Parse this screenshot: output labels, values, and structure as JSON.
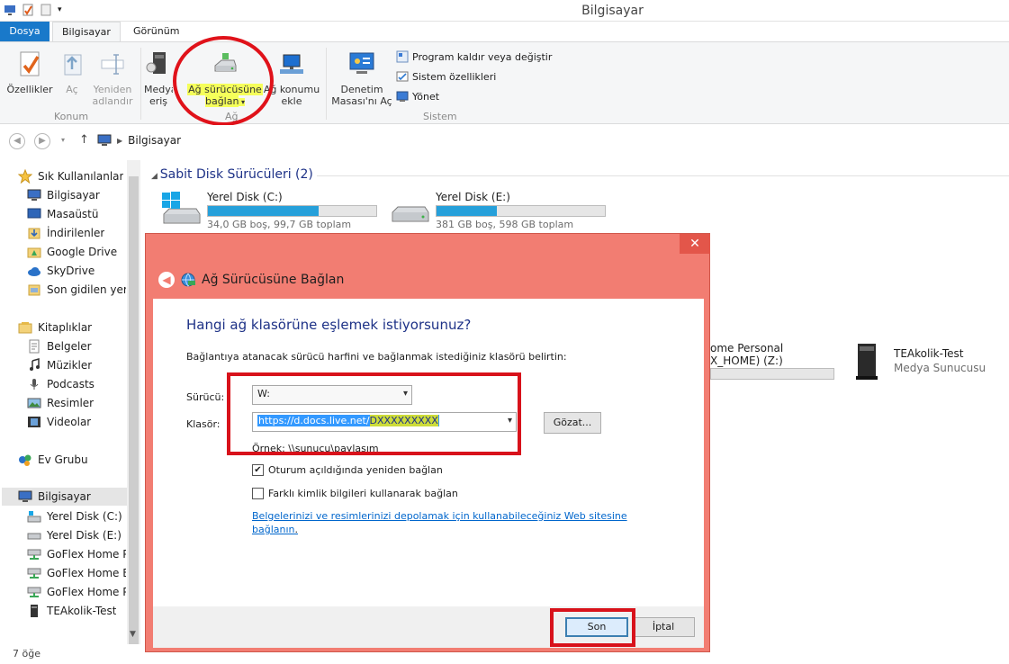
{
  "window": {
    "title": "Bilgisayar"
  },
  "tabs": {
    "file": "Dosya",
    "computer": "Bilgisayar",
    "view": "Görünüm"
  },
  "ribbon": {
    "properties": "Özellikler",
    "open": "Aç",
    "rename_1": "Yeniden",
    "rename_2": "adlandır",
    "group_location": "Konum",
    "media_1": "Medya",
    "media_2": "eriş",
    "map_drive_1": "Ağ sürücüsüne",
    "map_drive_2": "bağlan",
    "add_location_1": "Ağ konumu",
    "add_location_2": "ekle",
    "group_network": "Ağ",
    "control_panel_1": "Denetim",
    "control_panel_2": "Masası'nı Aç",
    "uninstall": "Program kaldır veya değiştir",
    "system_props": "Sistem özellikleri",
    "manage": "Yönet",
    "group_system": "Sistem"
  },
  "address": {
    "path": "Bilgisayar"
  },
  "nav": {
    "favorites": "Sık Kullanılanlar",
    "fav_computer": "Bilgisayar",
    "desktop": "Masaüstü",
    "downloads": "İndirilenler",
    "google_drive": "Google Drive",
    "skydrive": "SkyDrive",
    "recent": "Son gidilen yerler",
    "libraries": "Kitaplıklar",
    "documents": "Belgeler",
    "music": "Müzikler",
    "podcasts": "Podcasts",
    "pictures": "Resimler",
    "videos": "Videolar",
    "homegroup": "Ev Grubu",
    "computer": "Bilgisayar",
    "disk_c": "Yerel Disk (C:)",
    "disk_e": "Yerel Disk (E:)",
    "goflex_1": "GoFlex Home Pu",
    "goflex_2": "GoFlex Home Ba",
    "goflex_3": "GoFlex Home Pe",
    "teakolik": "TEAkolik-Test"
  },
  "status": {
    "items": "7 öğe"
  },
  "content": {
    "section_disks": "Sabit Disk Sürücüleri (2)",
    "drives": [
      {
        "name": "Yerel Disk (C:)",
        "info": "34,0 GB boş, 99,7 GB toplam",
        "used_fraction": 0.66
      },
      {
        "name": "Yerel Disk (E:)",
        "info": "381 GB boş, 598 GB toplam",
        "used_fraction": 0.36
      }
    ],
    "net_drive_line1": "ome Personal",
    "net_drive_line2": "X_HOME) (Z:)",
    "media_server_name": "TEAkolik-Test",
    "media_server_type": "Medya Sunucusu"
  },
  "dialog": {
    "title": "Ağ Sürücüsüne Bağlan",
    "question": "Hangi ağ klasörüne eşlemek istiyorsunuz?",
    "hint": "Bağlantıya atanacak sürücü harfini ve bağlanmak istediğiniz klasörü belirtin:",
    "drive_label": "Sürücü:",
    "drive_value": "W:",
    "folder_label": "Klasör:",
    "folder_value_prefix": "https://d.docs.live.net/",
    "folder_value_hidden": "DXXXXXXXXX",
    "browse": "Gözat...",
    "example": "Örnek: \\\\sunucu\\paylaşım",
    "reconnect": "Oturum açıldığında yeniden bağlan",
    "reconnect_checked": true,
    "other_creds": "Farklı kimlik bilgileri kullanarak bağlan",
    "other_creds_checked": false,
    "link": "Belgelerinizi ve resimlerinizi depolamak için kullanabileceğiniz Web sitesine bağlanın",
    "link_tail": ".",
    "finish": "Son",
    "cancel": "İptal"
  },
  "colors": {
    "accent": "#1979ca",
    "dialog_frame": "#f27d72",
    "annotation_red": "#d8121b",
    "highlight": "#f5ff5a"
  }
}
